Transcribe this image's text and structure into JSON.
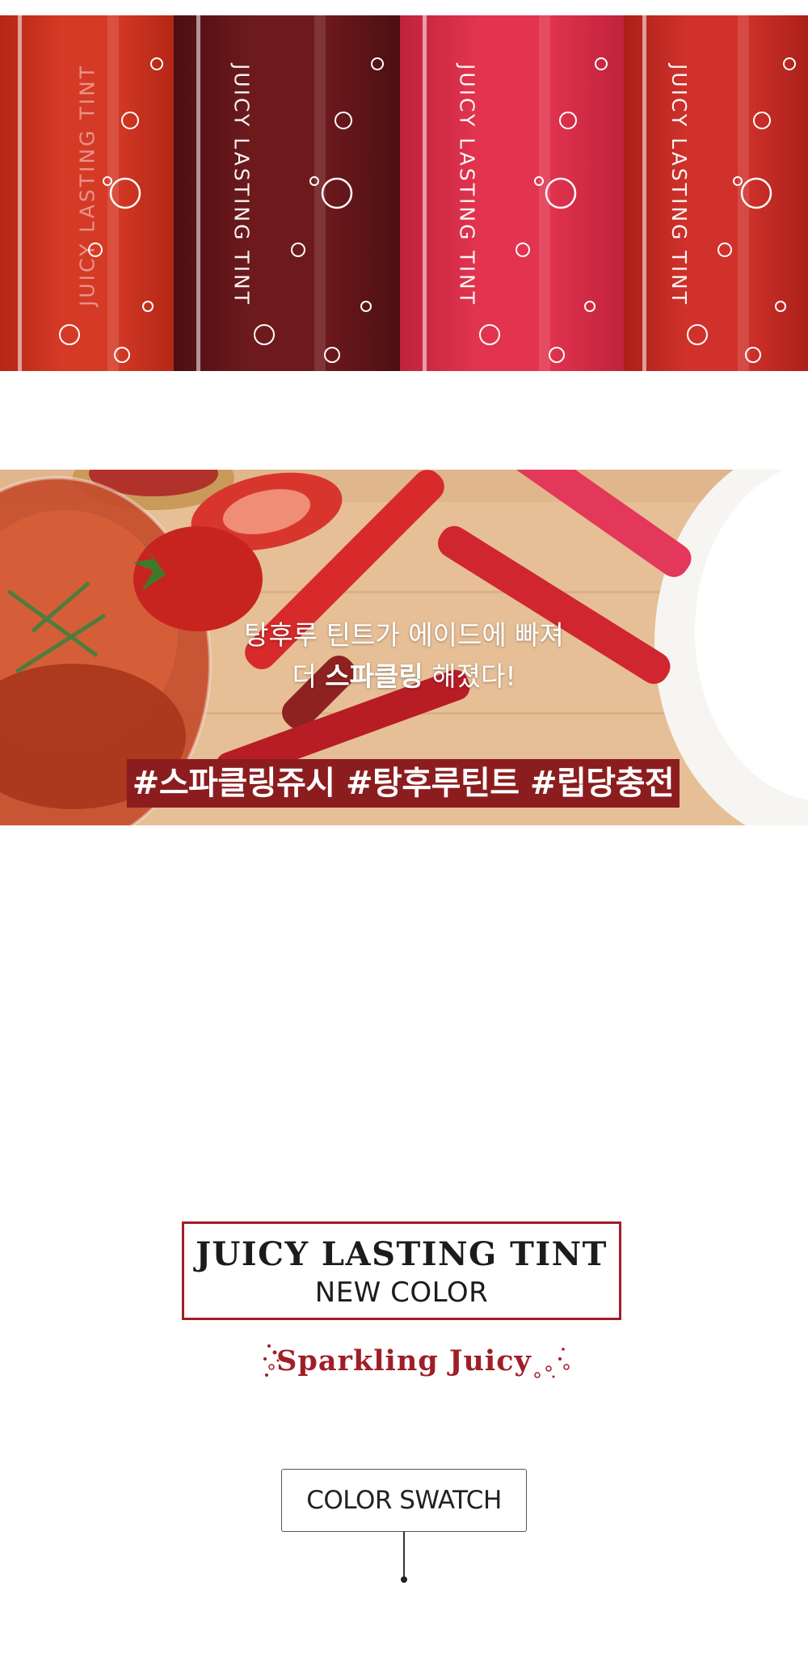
{
  "hero": {
    "tubes": [
      {
        "label": "JUICY LASTING TINT",
        "color": "#d53a26",
        "dark": "#b32616",
        "fruit": "cherry-icon"
      },
      {
        "label": "JUICY LASTING TINT",
        "color": "#6e1a1d",
        "dark": "#4c0f12",
        "fruit": "peach-icon"
      },
      {
        "label": "JUICY LASTING TINT",
        "color": "#e2344f",
        "dark": "#c0223c",
        "fruit": "watermelon-icon"
      },
      {
        "label": "JUICY LASTING TINT",
        "color": "#d0322b",
        "dark": "#ab2019",
        "fruit": "strawberry-icon"
      }
    ]
  },
  "scene": {
    "caption_line1": "탕후루 틴트가 에이드에 빠져",
    "caption_line2_pre": "더 ",
    "caption_line2_bold": "스파클링",
    "caption_line2_post": " 해졌다!",
    "hashtags": "#스파클링쥬시 #탕후루틴트 #립당충전",
    "hashtag_bg": "#8b1d1f"
  },
  "title": {
    "product_name": "JUICY LASTING TINT",
    "subtitle": "NEW COLOR",
    "tagline": "Sparkling Juicy",
    "accent": "#a01e28"
  },
  "swatch": {
    "button_label": "COLOR SWATCH"
  }
}
